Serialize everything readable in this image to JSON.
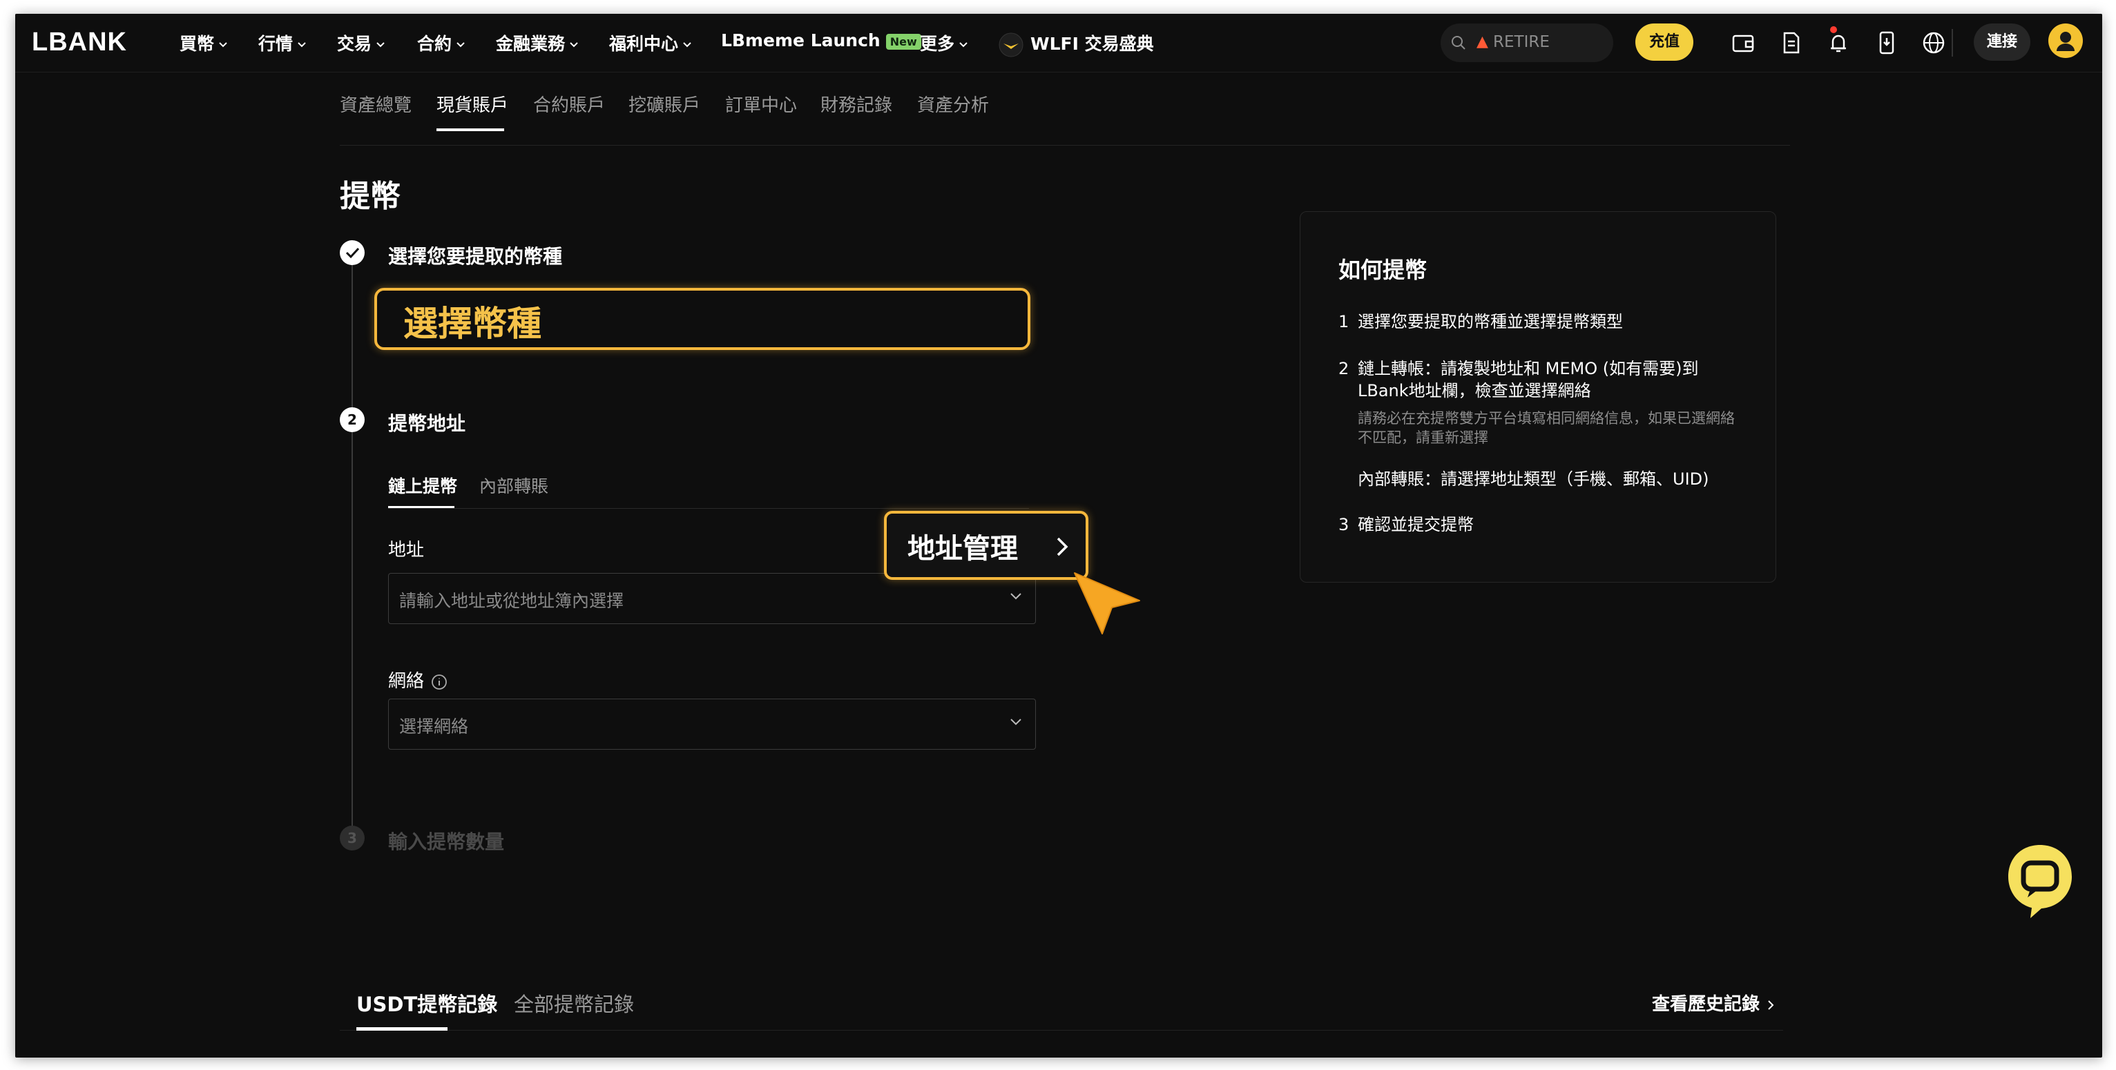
{
  "colors": {
    "accent": "#F6B73C",
    "deposit_button": "#F4D03F",
    "new_badge": "#84D26A",
    "notification_dot": "#FF3B30"
  },
  "nav": {
    "logo": "LBANK",
    "items": [
      "買幣",
      "行情",
      "交易",
      "合約",
      "金融業務",
      "福利中心"
    ],
    "launch": "LBmeme Launch",
    "launch_badge": "New",
    "more": "更多",
    "promo": "WLFI 交易盛典",
    "search_text": "RETIRE",
    "deposit": "充值",
    "connect": "連接",
    "icons": [
      "wallet-icon",
      "document-icon",
      "bell-icon",
      "mobile-download-icon",
      "globe-icon"
    ]
  },
  "subtabs": [
    "資產總覽",
    "現貨賬戶",
    "合約賬戶",
    "挖礦賬戶",
    "訂單中心",
    "財務記錄",
    "資產分析"
  ],
  "subtab_active": "現貨賬戶",
  "page_title": "提幣",
  "steps": {
    "step1_label": "選擇您要提取的幣種",
    "coin_select": "選擇幣種",
    "step2_num": "2",
    "step2_label": "提幣地址",
    "chain_tab": "鏈上提幣",
    "internal_tab": "內部轉賬",
    "address_label": "地址",
    "address_placeholder": "請輸入地址或從地址簿內選擇",
    "network_label": "網絡",
    "network_placeholder": "選擇網絡",
    "step3_num": "3",
    "step3_label": "輸入提幣數量"
  },
  "address_manager": "地址管理",
  "guide": {
    "title": "如何提幣",
    "n1": "1",
    "item1": "選擇您要提取的幣種並選擇提幣類型",
    "n2": "2",
    "item2": "鏈上轉帳：請複製地址和 MEMO (如有需要)到LBank地址欄，檢查並選擇網絡",
    "item2_note": "請務必在充提幣雙方平台填寫相同網絡信息，如果已選網絡不匹配，請重新選擇",
    "item2_internal": "內部轉賬：請選擇地址類型（手機、郵箱、UID)",
    "n3": "3",
    "item3": "確認並提交提幣"
  },
  "history": {
    "tab_usdt": "USDT提幣記錄",
    "tab_all": "全部提幣記錄",
    "view_history": "查看歷史記錄"
  }
}
